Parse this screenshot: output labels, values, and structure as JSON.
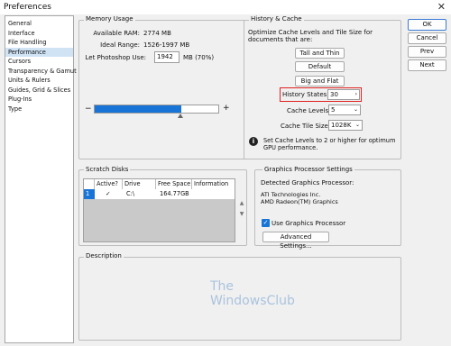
{
  "window": {
    "title": "Preferences",
    "close_glyph": "✕"
  },
  "sidebar": {
    "items": [
      {
        "label": "General"
      },
      {
        "label": "Interface"
      },
      {
        "label": "File Handling"
      },
      {
        "label": "Performance"
      },
      {
        "label": "Cursors"
      },
      {
        "label": "Transparency & Gamut"
      },
      {
        "label": "Units & Rulers"
      },
      {
        "label": "Guides, Grid & Slices"
      },
      {
        "label": "Plug-Ins"
      },
      {
        "label": "Type"
      }
    ],
    "selected_index": 3
  },
  "buttons": {
    "ok": "OK",
    "cancel": "Cancel",
    "prev": "Prev",
    "next": "Next"
  },
  "memory": {
    "title": "Memory Usage",
    "available_label": "Available RAM:",
    "available_value": "2774 MB",
    "ideal_label": "Ideal Range:",
    "ideal_value": "1526-1997 MB",
    "let_label": "Let Photoshop Use:",
    "let_value": "1942",
    "let_suffix": "MB (70%)",
    "minus": "−",
    "plus": "+",
    "slider_fraction": 0.7
  },
  "history": {
    "title": "History & Cache",
    "desc": "Optimize Cache Levels and Tile Size for documents that are:",
    "tall_thin": "Tall and Thin",
    "default": "Default",
    "big_flat": "Big and Flat",
    "states_label": "History States:",
    "states_value": "30",
    "levels_label": "Cache Levels:",
    "levels_value": "5",
    "tile_label": "Cache Tile Size:",
    "tile_value": "1028K",
    "info": "Set Cache Levels to 2 or higher for optimum GPU performance.",
    "highlight_color": "#e02020"
  },
  "scratch": {
    "title": "Scratch Disks",
    "columns": [
      "Active?",
      "Drive",
      "Free Space",
      "Information"
    ],
    "rows": [
      {
        "num": "1",
        "active": "✓",
        "drive": "C:\\",
        "free": "164.77GB",
        "info": ""
      }
    ]
  },
  "gpu": {
    "title": "Graphics Processor Settings",
    "detected": "Detected Graphics Processor:",
    "line1": "ATI Technologies Inc.",
    "line2": "AMD Radeon(TM) Graphics",
    "use_label": "Use Graphics Processor",
    "advanced": "Advanced Settings..."
  },
  "description": {
    "title": "Description"
  },
  "watermark": {
    "line1": "The",
    "line2": "WindowsClub"
  }
}
